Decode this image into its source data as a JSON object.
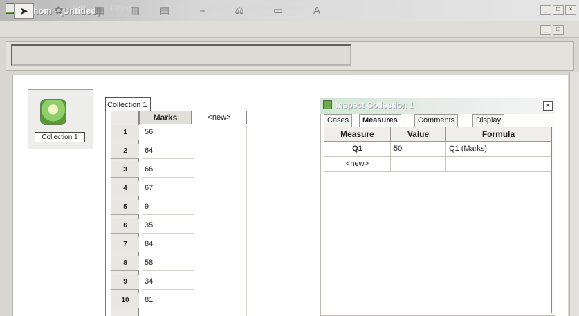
{
  "window": {
    "title": "Fathom - [Untitled]",
    "icon": "app-logo-icon",
    "controls": [
      "minimize",
      "restore",
      "close"
    ]
  },
  "menubar": {
    "items": [
      "File",
      "Edit",
      "Object",
      "Table",
      "Analyze",
      "Window",
      "Help"
    ]
  },
  "toolbar": {
    "tools": [
      {
        "name": "select-tool-icon",
        "glyph": "➤",
        "selected": true
      },
      {
        "name": "collection-tool-icon",
        "glyph": "✿",
        "selected": false
      },
      {
        "name": "table-tool-icon",
        "glyph": "▦",
        "selected": false
      },
      {
        "name": "graph-tool-icon",
        "glyph": "▥",
        "selected": false
      },
      {
        "name": "summary-tool-icon",
        "glyph": "▤",
        "selected": false
      },
      {
        "name": "estimate-tool-icon",
        "glyph": "⎯",
        "selected": false
      },
      {
        "name": "test-tool-icon",
        "glyph": "⚖",
        "selected": false
      },
      {
        "name": "slider-tool-icon",
        "glyph": "▭",
        "selected": false
      },
      {
        "name": "text-tool-icon",
        "glyph": "A",
        "selected": false
      }
    ]
  },
  "collection": {
    "label": "Collection 1",
    "icon": "collection-box-icon"
  },
  "case_table": {
    "tab_label": "Collection 1",
    "column_header": "Marks",
    "new_column_label": "<new>",
    "rows": [
      {
        "index": "1",
        "value": "56"
      },
      {
        "index": "2",
        "value": "64"
      },
      {
        "index": "3",
        "value": "66"
      },
      {
        "index": "4",
        "value": "67"
      },
      {
        "index": "5",
        "value": "9"
      },
      {
        "index": "6",
        "value": "35"
      },
      {
        "index": "7",
        "value": "84"
      },
      {
        "index": "8",
        "value": "58"
      },
      {
        "index": "9",
        "value": "34"
      },
      {
        "index": "10",
        "value": "81"
      }
    ]
  },
  "inspector": {
    "title": "Inspect Collection 1",
    "close_label": "×",
    "tabs": [
      {
        "label": "Cases",
        "active": false
      },
      {
        "label": "Measures",
        "active": true
      },
      {
        "label": "Comments",
        "active": false
      },
      {
        "label": "Display",
        "active": false
      }
    ],
    "measure_columns": [
      "Measure",
      "Value",
      "Formula"
    ],
    "measure_rows": [
      {
        "measure": "Q1",
        "value": "50",
        "formula": "Q1 (Marks)"
      },
      {
        "measure": "<new>",
        "value": "",
        "formula": ""
      }
    ]
  },
  "colors": {
    "workspace_bg": "#ffffff",
    "chrome_bg": "#d8d6d0"
  }
}
